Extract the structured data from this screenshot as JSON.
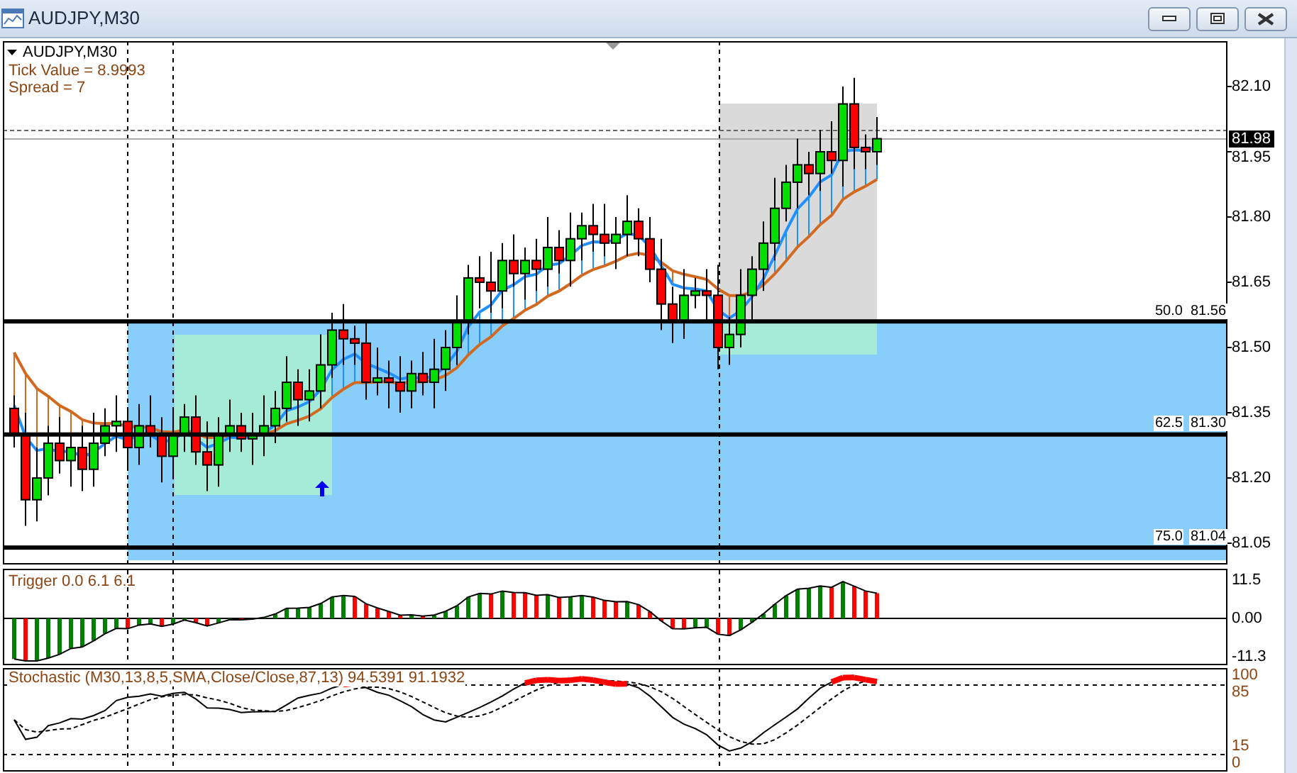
{
  "window": {
    "title": "AUDJPY,M30"
  },
  "main_chart": {
    "symbol": "AUDJPY,M30",
    "info_lines": [
      "Tick Value = 8.9993",
      "Spread = 7"
    ],
    "price_axis": [
      "82.10",
      "81.95",
      "81.80",
      "81.65",
      "81.50",
      "81.35",
      "81.20",
      "81.05"
    ],
    "current_price": "81.98",
    "fib_levels": [
      {
        "percent": "50.0",
        "price": "81.56"
      },
      {
        "percent": "62.5",
        "price": "81.30"
      },
      {
        "percent": "75.0",
        "price": "81.04"
      }
    ]
  },
  "trigger_panel": {
    "title": "Trigger 0.0 6.1 6.1",
    "axis": [
      "11.5",
      "0.00",
      "-11.3"
    ]
  },
  "stochastic_panel": {
    "title": "Stochastic (M30,13,8,5,SMA,Close/Close,87,13) 94.5391 91.1932",
    "axis": [
      "100",
      "85",
      "15",
      "0"
    ]
  }
}
